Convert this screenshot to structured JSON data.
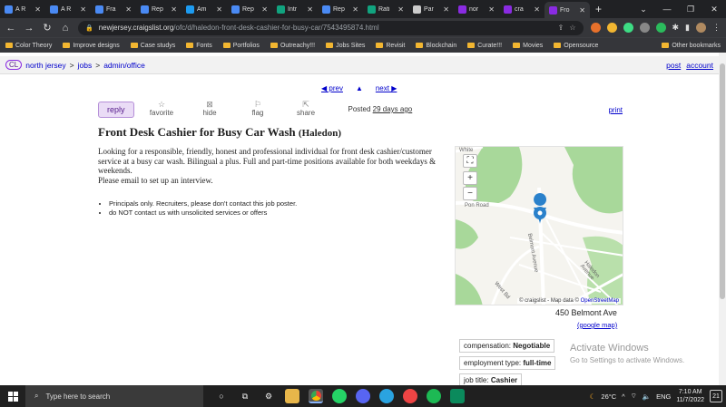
{
  "browser": {
    "tabs": [
      {
        "label": "A R",
        "color": "#4a8af4"
      },
      {
        "label": "A R",
        "color": "#4a8af4"
      },
      {
        "label": "Fra",
        "color": "#4a8af4"
      },
      {
        "label": "Rep",
        "color": "#4a8af4"
      },
      {
        "label": "Am",
        "color": "#1d9bf0"
      },
      {
        "label": "Rep",
        "color": "#4a8af4"
      },
      {
        "label": "Intr",
        "color": "#11a37f"
      },
      {
        "label": "Rep",
        "color": "#4a8af4"
      },
      {
        "label": "Rati",
        "color": "#11a37f"
      },
      {
        "label": "Par",
        "color": "#cccccc"
      },
      {
        "label": "nor",
        "color": "#8a2be2"
      },
      {
        "label": "cra",
        "color": "#8a2be2"
      },
      {
        "label": "Fro",
        "color": "#8a2be2"
      }
    ],
    "url_host": "newjersey.craigslist.org",
    "url_path": "/ofc/d/haledon-front-desk-cashier-for-busy-car/7543495874.html",
    "bookmarks": [
      "Color Theory",
      "Improve designs",
      "Case studys",
      "Fonts",
      "Portfolios",
      "Outreachy!!!",
      "Jobs Sites",
      "Revisit",
      "Blockchain",
      "Curate!!!",
      "Movies",
      "Opensource"
    ],
    "other_bookmarks": "Other bookmarks"
  },
  "breadcrumb": {
    "logo": "CL",
    "site": "north jersey",
    "sep1": ">",
    "section": "jobs",
    "sep2": ">",
    "category": "admin/office",
    "post": "post",
    "account": "account"
  },
  "nav": {
    "prev": "◀ prev",
    "up": "▲",
    "next": "next ▶"
  },
  "actions": {
    "reply": "reply",
    "favorite": "favorite",
    "hide": "hide",
    "flag": "flag",
    "share": "share",
    "posted_label": "Posted",
    "posted_time": "29 days ago",
    "print": "print"
  },
  "posting": {
    "title": "Front Desk Cashier for Busy Car Wash",
    "location": "(Haledon)",
    "body_line1": "Looking for a responsible, friendly, honest and professional individual for front desk cashier/customer service at a busy car wash. Bilingual a plus. Full and part-time positions available for both weekdays & weekends.",
    "body_line2": "Please email to set up an interview.",
    "notices": [
      "Principals only. Recruiters, please don't contact this job poster.",
      "do NOT contact us with unsolicited services or offers"
    ]
  },
  "map": {
    "attribution_prefix": "© craigslist - Map data ©",
    "attribution_link": "OpenStreetMap",
    "labels": {
      "road1": "Belmont Avenue",
      "road2": "Haledon Avenue",
      "road3": "West Bd",
      "road4": "Pon Road",
      "top": "White"
    },
    "address": "450 Belmont Ave",
    "google_map": "(google map)"
  },
  "attributes": [
    {
      "label": "compensation:",
      "value": "Negotiable"
    },
    {
      "label": "employment type:",
      "value": "full-time"
    },
    {
      "label": "job title:",
      "value": "Cashier"
    }
  ],
  "watermark": {
    "line1": "Activate Windows",
    "line2": "Go to Settings to activate Windows."
  },
  "taskbar": {
    "search_placeholder": "Type here to search",
    "weather": "26°C",
    "lang": "ENG",
    "time": "7:10 AM",
    "date": "11/7/2022",
    "notifications": "21"
  },
  "colors": {
    "accent": "#551a8b",
    "link": "#0000cc",
    "park": "#a8d89a",
    "road": "#ffffff",
    "pin": "#2a81cb"
  }
}
